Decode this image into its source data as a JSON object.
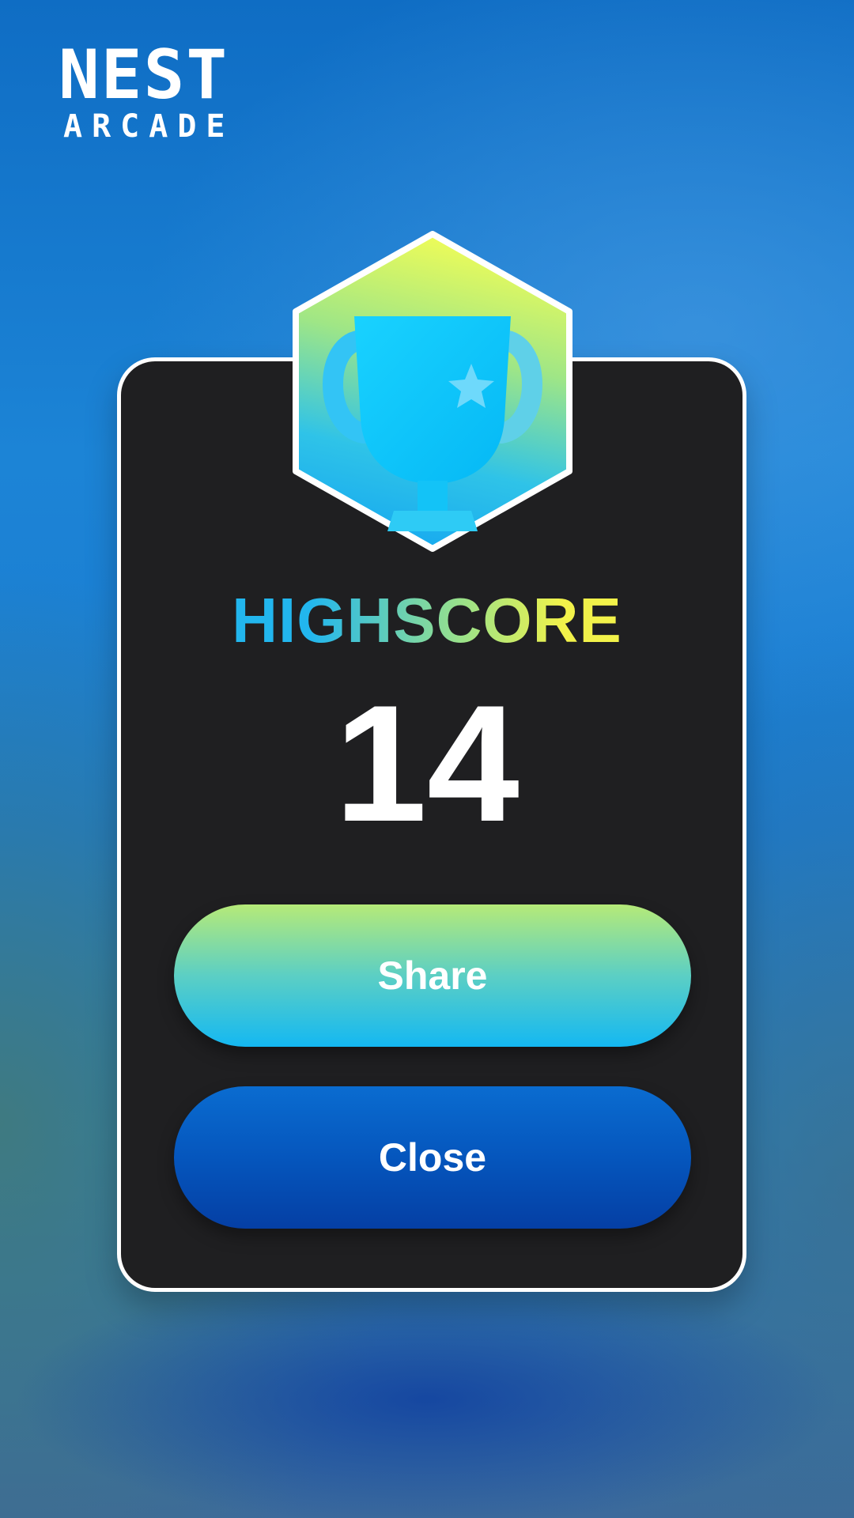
{
  "logo": {
    "line1": "NEST",
    "line2": "ARCADE"
  },
  "badge": {
    "icon": "trophy-icon"
  },
  "highscore": {
    "label": "HIGHSCORE",
    "value": "14"
  },
  "buttons": {
    "share_label": "Share",
    "close_label": "Close"
  },
  "colors": {
    "card_background": "#1f1f21",
    "share_gradient": [
      "#b6ea78",
      "#14b8f2"
    ],
    "close_gradient": [
      "#0a6cd0",
      "#053fa4"
    ],
    "title_gradient": [
      "#22b6ee",
      "#f2f24a"
    ]
  }
}
